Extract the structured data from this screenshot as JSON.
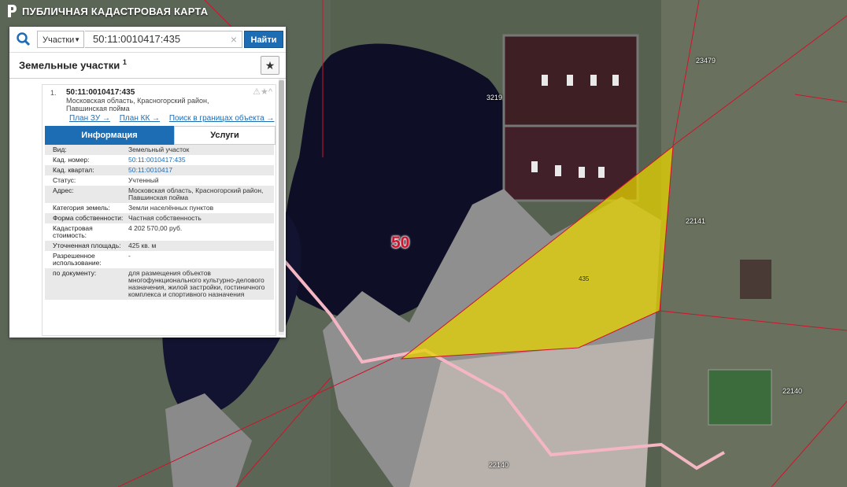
{
  "app": {
    "title": "ПУБЛИЧНАЯ КАДАСТРОВАЯ КАРТА"
  },
  "search": {
    "type_label": "Участки",
    "query": "50:11:0010417:435",
    "find_label": "Найти",
    "clear_symbol": "×"
  },
  "results": {
    "title": "Земельные участки",
    "count": "1",
    "fav_symbol": "★"
  },
  "item": {
    "index": "1.",
    "cad_number": "50:11:0010417:435",
    "address": "Московская область, Красногорский район, Павшинская пойма",
    "tools": "⚠★^",
    "links": [
      "План ЗУ →",
      "План КК →",
      "Поиск в границах объекта →"
    ]
  },
  "tabs": {
    "info": "Информация",
    "services": "Услуги"
  },
  "properties": [
    {
      "key": "Вид:",
      "value": "Земельный участок",
      "link": false
    },
    {
      "key": "Кад. номер:",
      "value": "50:11:0010417:435",
      "link": true
    },
    {
      "key": "Кад. квартал:",
      "value": "50:11:0010417",
      "link": true
    },
    {
      "key": "Статус:",
      "value": "Учтенный",
      "link": false
    },
    {
      "key": "Адрес:",
      "value": "Московская область, Красногорский район, Павшинская пойма",
      "link": false
    },
    {
      "key": "Категория земель:",
      "value": "Земли населённых пунктов",
      "link": false
    },
    {
      "key": "Форма собственности:",
      "value": "Частная собственность",
      "link": false
    },
    {
      "key": "Кадастровая стоимость:",
      "value": "4 202 570,00 руб.",
      "link": false
    },
    {
      "key": "Уточненная площадь:",
      "value": "425 кв. м",
      "link": false
    },
    {
      "key": "Разрешенное использование:",
      "value": "-",
      "link": false
    },
    {
      "key": "по документу:",
      "value": "для размещения объектов многофункционального культурно-делового назначения, жилой застройки, гостиничного комплекса и спортивного назначения",
      "link": false
    }
  ],
  "map": {
    "district_label": "50",
    "parcel_label": "435",
    "labels": [
      "23479",
      "3219",
      "22141",
      "22140",
      "22140"
    ],
    "colors": {
      "parcel_fill": "#e6d300",
      "boundary": "#d0132c",
      "road": "#f4b6c2"
    }
  }
}
